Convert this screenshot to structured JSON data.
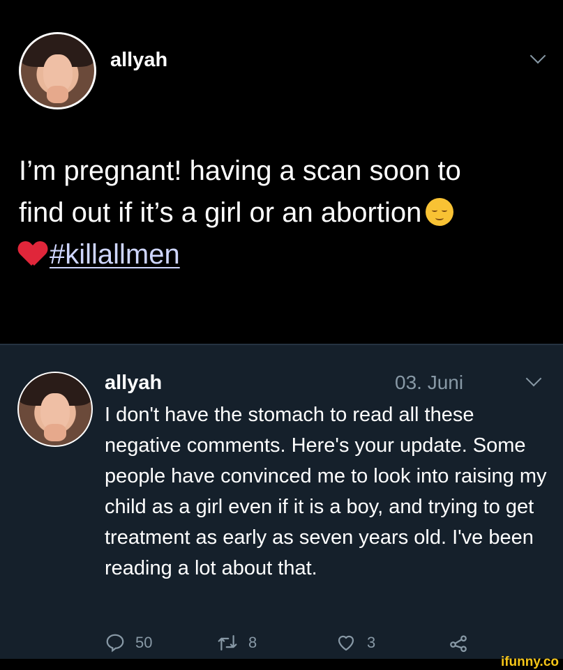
{
  "top_post": {
    "username": "allyah",
    "line1": "I’m pregnant! having a scan soon to",
    "line2": "find out if it’s a girl or an abortion",
    "hashtag": "#killallmen"
  },
  "reply_post": {
    "username": "allyah",
    "date": "03. Juni",
    "text": "I don't have the stomach to read all these negative comments. Here's your update. Some people have convinced me to look into raising my child as a girl even if it is a boy, and trying to get treatment as early as seven years old. I've been reading a lot about that.",
    "reply_count": "50",
    "retweet_count": "8",
    "like_count": "3"
  },
  "watermark": "ifunny.co",
  "colors": {
    "top_bg": "#000000",
    "reply_bg": "#15202b",
    "muted": "#8899a6",
    "heart": "#e0263a",
    "watermark": "#f5c518"
  },
  "icons": [
    "avatar",
    "chevron-down-icon",
    "relieved-face-emoji",
    "red-heart-emoji",
    "reply-icon",
    "retweet-icon",
    "like-icon",
    "share-icon"
  ]
}
